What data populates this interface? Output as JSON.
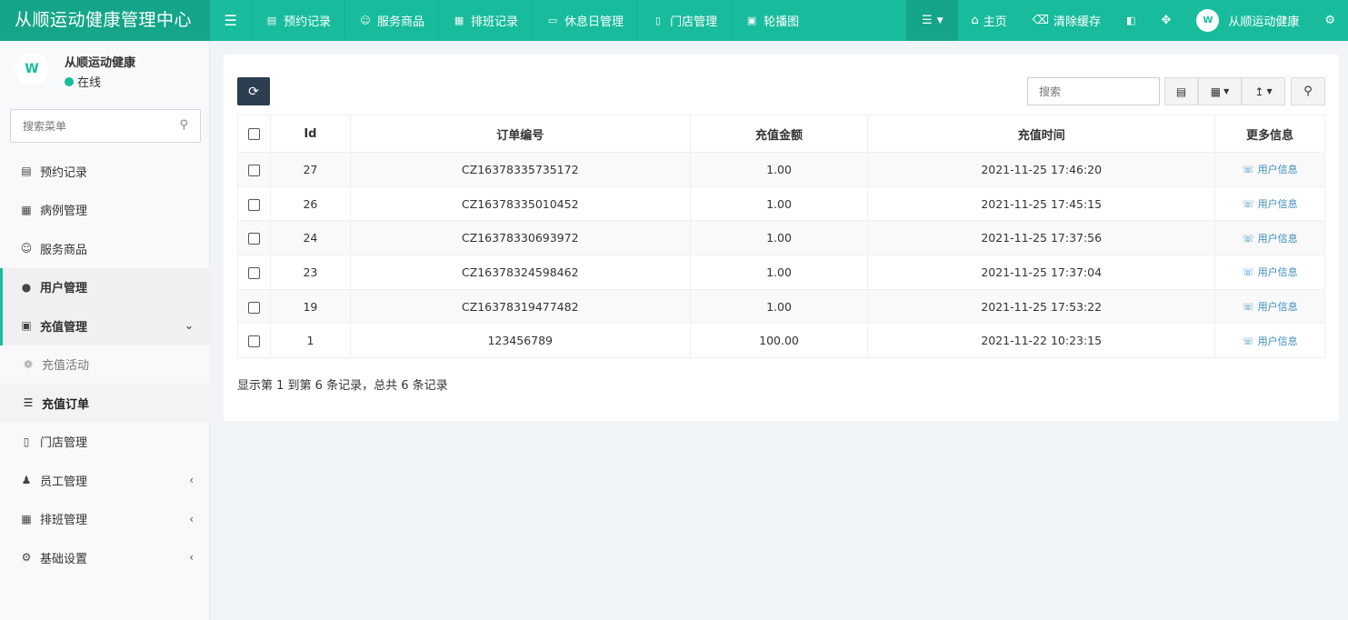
{
  "app": {
    "title": "从顺运动健康管理中心"
  },
  "topnav": {
    "items": [
      {
        "label": "预约记录",
        "icon": "list-icon"
      },
      {
        "label": "服务商品",
        "icon": "smile-icon"
      },
      {
        "label": "排班记录",
        "icon": "grid-icon"
      },
      {
        "label": "休息日管理",
        "icon": "bed-icon"
      },
      {
        "label": "门店管理",
        "icon": "building-icon"
      },
      {
        "label": "轮播图",
        "icon": "image-icon"
      }
    ],
    "home_label": "主页",
    "clear_cache_label": "清除缓存",
    "user_label": "从顺运动健康"
  },
  "sidebar": {
    "user_name": "从顺运动健康",
    "status": "在线",
    "search_placeholder": "搜索菜单",
    "items": [
      {
        "label": "预约记录"
      },
      {
        "label": "病例管理"
      },
      {
        "label": "服务商品"
      },
      {
        "label": "用户管理"
      },
      {
        "label": "充值管理"
      },
      {
        "label": "充值活动"
      },
      {
        "label": "充值订单"
      },
      {
        "label": "门店管理"
      },
      {
        "label": "员工管理"
      },
      {
        "label": "排班管理"
      },
      {
        "label": "基础设置"
      }
    ]
  },
  "toolbar": {
    "search_placeholder": "搜索"
  },
  "table": {
    "headers": [
      "Id",
      "订单编号",
      "充值金额",
      "充值时间",
      "更多信息"
    ],
    "link_label": "用户信息",
    "rows": [
      {
        "id": "27",
        "order_no": "CZ16378335735172",
        "amount": "1.00",
        "time": "2021-11-25 17:46:20"
      },
      {
        "id": "26",
        "order_no": "CZ16378335010452",
        "amount": "1.00",
        "time": "2021-11-25 17:45:15"
      },
      {
        "id": "24",
        "order_no": "CZ16378330693972",
        "amount": "1.00",
        "time": "2021-11-25 17:37:56"
      },
      {
        "id": "23",
        "order_no": "CZ16378324598462",
        "amount": "1.00",
        "time": "2021-11-25 17:37:04"
      },
      {
        "id": "19",
        "order_no": "CZ16378319477482",
        "amount": "1.00",
        "time": "2021-11-25 17:53:22"
      },
      {
        "id": "1",
        "order_no": "123456789",
        "amount": "100.00",
        "time": "2021-11-22 10:23:15"
      }
    ]
  },
  "pagination": {
    "summary": "显示第 1 到第 6 条记录，总共 6 条记录"
  },
  "colors": {
    "brand": "#18bc9c",
    "brand_dark": "#15a589",
    "dark_button": "#2c3e50",
    "link": "#3c8dbc"
  }
}
